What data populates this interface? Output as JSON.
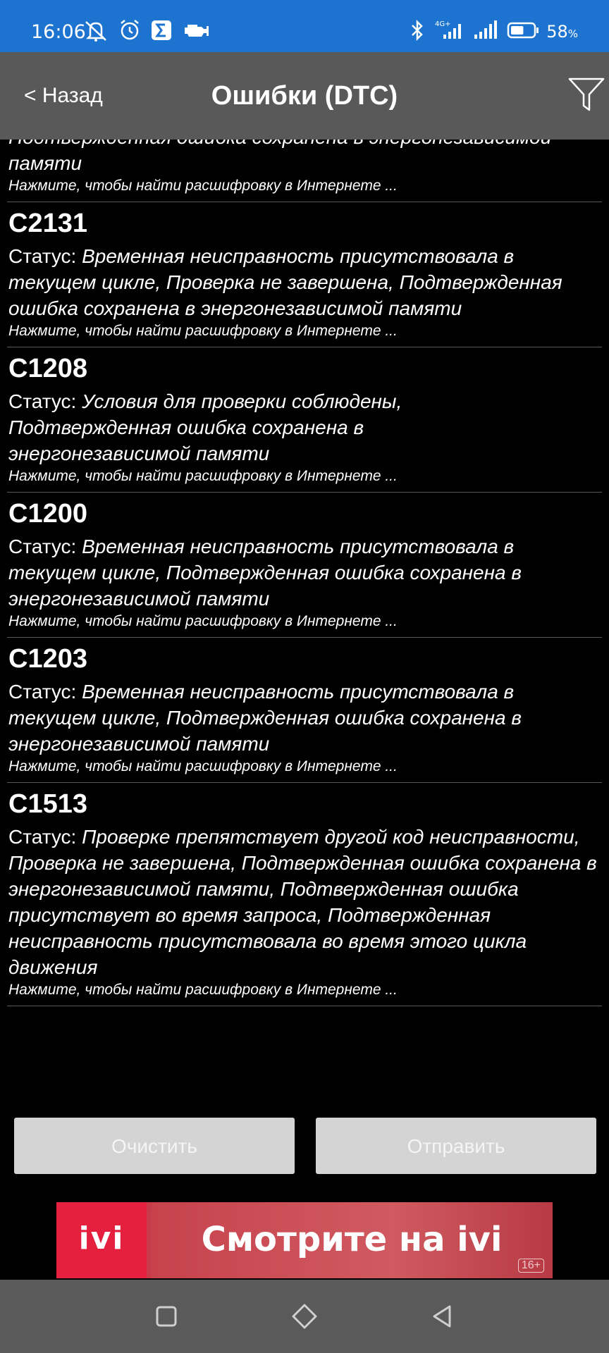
{
  "status_bar": {
    "time": "16:06",
    "icons_left": [
      "mute-bell-icon",
      "alarm-icon",
      "sigma-app-icon",
      "engine-icon"
    ],
    "icons_right": [
      "bluetooth-icon",
      "4g-signal-icon",
      "signal-icon",
      "battery-icon"
    ],
    "network": "4G+",
    "battery_value": "58",
    "battery_unit": "%",
    "battery_level": 0.58
  },
  "header": {
    "back_label": "< Назад",
    "title": "Ошибки (DTC)",
    "filter_icon": "filter-icon"
  },
  "dtc_partial": {
    "status_tail": "Подтвержденная ошибка сохранена в энергонезависимой памяти",
    "hint": "Нажмите, чтобы найти расшифровку в Интернете ..."
  },
  "dtc_items": [
    {
      "code": "C2131",
      "status_label": "Статус: ",
      "status": "Временная неисправность присутствовала в текущем цикле, Проверка не завершена, Подтвержденная ошибка сохранена в энергонезависимой памяти",
      "hint": "Нажмите, чтобы найти расшифровку в Интернете ..."
    },
    {
      "code": "C1208",
      "status_label": "Статус: ",
      "status": "Условия для проверки соблюдены, Подтвержденная ошибка сохранена в энергонезависимой памяти",
      "hint": "Нажмите, чтобы найти расшифровку в Интернете ..."
    },
    {
      "code": "C1200",
      "status_label": "Статус: ",
      "status": "Временная неисправность присутствовала в текущем цикле, Подтвержденная ошибка сохранена в энергонезависимой памяти",
      "hint": "Нажмите, чтобы найти расшифровку в Интернете ..."
    },
    {
      "code": "C1203",
      "status_label": "Статус: ",
      "status": "Временная неисправность присутствовала в текущем цикле, Подтвержденная ошибка сохранена в энергонезависимой памяти",
      "hint": "Нажмите, чтобы найти расшифровку в Интернете ..."
    },
    {
      "code": "C1513",
      "status_label": "Статус: ",
      "status": "Проверке препятствует другой код неисправности, Проверка не завершена, Подтвержденная ошибка сохранена в энергонезависимой памяти, Подтвержденная ошибка присутствует во время запроса, Подтвержденная неисправность присутствовала во время этого цикла движения",
      "hint": "Нажмите, чтобы найти расшифровку в Интернете ..."
    }
  ],
  "actions": {
    "clear_label": "Очистить",
    "send_label": "Отправить"
  },
  "ad": {
    "logo_text": "ivi",
    "text": "Смотрите на ivi",
    "age": "16+"
  },
  "nav_bar": {
    "icons": [
      "recent-apps-icon",
      "home-icon",
      "back-icon"
    ]
  },
  "colors": {
    "status_bar": "#1d74d0",
    "header": "#595959",
    "background": "#000000",
    "button": "#d4d4d4",
    "ad": "#e5203f"
  }
}
